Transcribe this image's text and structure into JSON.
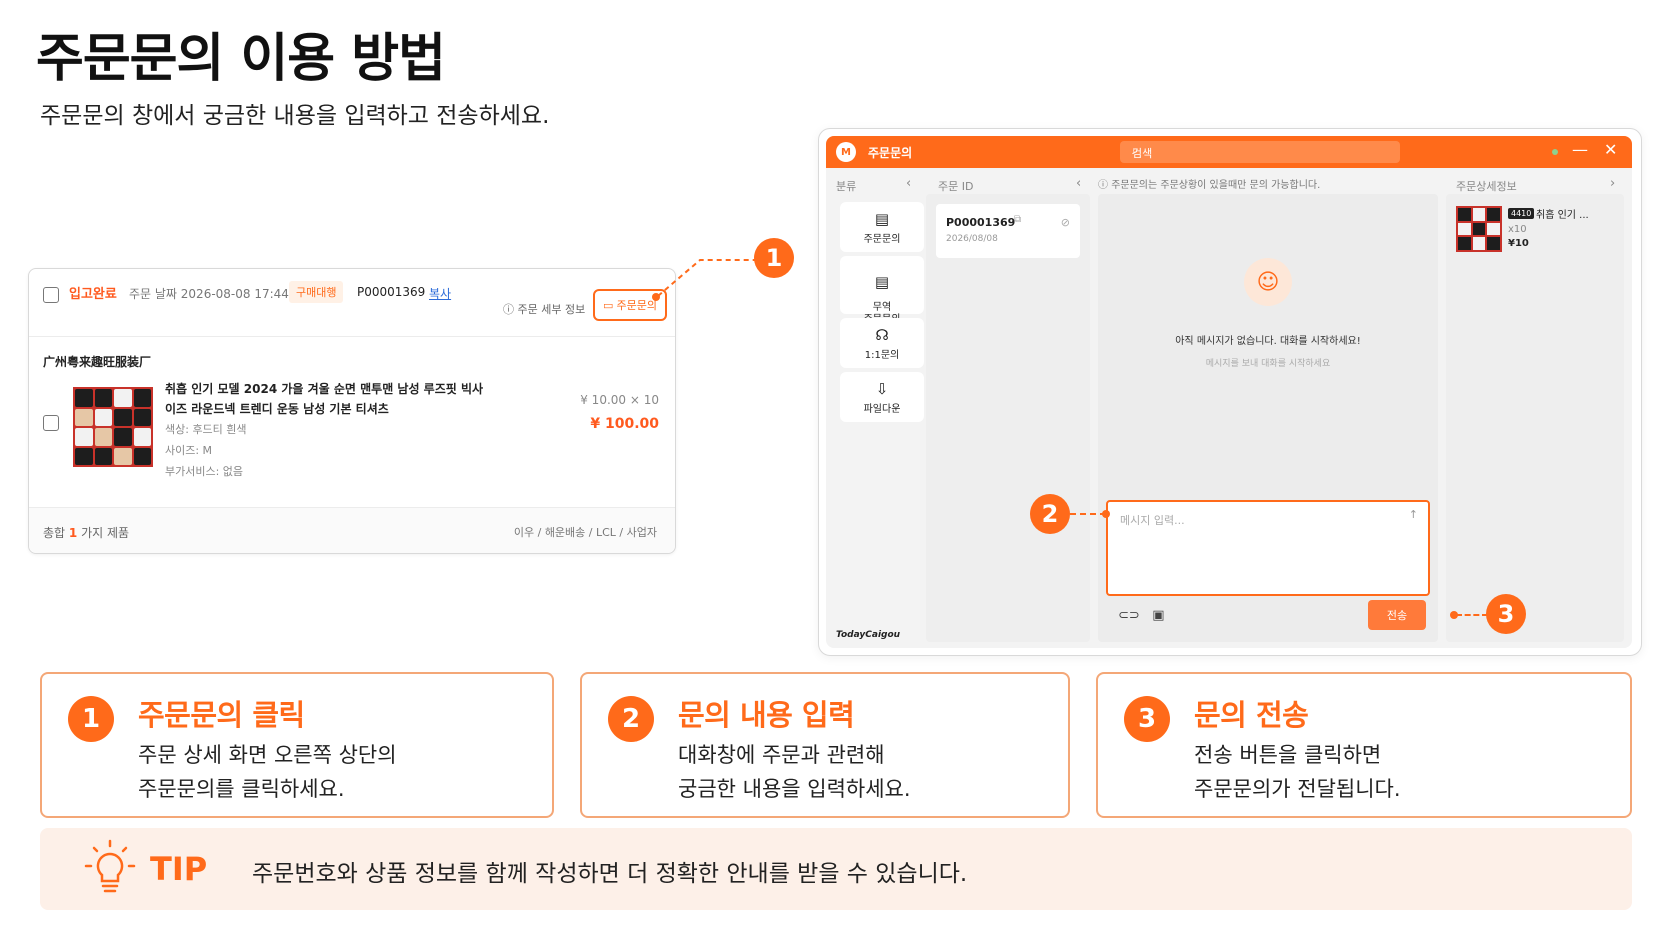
{
  "page": {
    "title": "주문문의 이용 방법",
    "subtitle": "주문문의 창에서 궁금한 내용을 입력하고 전송하세요."
  },
  "order_card": {
    "status": "입고완료",
    "date_label": "주문 날짜 2026-08-08 17:44",
    "badge": "구매대행",
    "order_id": "P00001369",
    "copy_label": "복사",
    "detail_label": "주문 세부 정보",
    "inquiry_label": "주문문의",
    "seller": "广州粤来趣旺服装厂",
    "product_name": "취흡 인기 모델 2024 가을 겨울 순면 맨투맨 남성 루즈핏 빅사이즈 라운드넥 트렌디 운동 남성 기본 티셔츠",
    "option_color": "색상: 후드티 흰색",
    "option_size": "사이즈: M",
    "option_extra": "부가서비스: 없음",
    "unit_price": "¥ 10.00 × 10",
    "total_price": "¥ 100.00",
    "footer_total_prefix": "총합",
    "footer_total_count": "1",
    "footer_total_suffix": "가지 제품",
    "footer_shipping": "이우 / 해운배송 / LCL / 사업자"
  },
  "markers": {
    "one": "1",
    "two": "2",
    "three": "3"
  },
  "window": {
    "logo": "M",
    "title": "주문문의",
    "search_placeholder": "검색",
    "col_category": "분류",
    "col_order_id": "주문 ID",
    "col_detail": "주문상세정보",
    "notice": "주문문의는 주문상황이 있을때만 문의 가능합니다.",
    "side_items": [
      {
        "label": "주문문의"
      },
      {
        "label": "무역\n주문문의"
      },
      {
        "label": "1:1문의"
      },
      {
        "label": "파일다운"
      }
    ],
    "brand": "TodayCaigou",
    "order_item": {
      "id": "P00001369",
      "date": "2026/08/08"
    },
    "empty_title": "아직 메시지가 없습니다. 대화를 시작하세요!",
    "empty_sub": "메시지를 보내 대화를 시작하세요",
    "input_placeholder": "메시지 입력...",
    "send_label": "전송",
    "detail_tag": "4410",
    "detail_name": "취흡 인기 ...",
    "detail_qty": "x10",
    "detail_price": "¥10"
  },
  "steps": [
    {
      "num": "1",
      "title": "주문문의 클릭",
      "line1": "주문 상세 화면 오른쪽 상단의",
      "line2": "주문문의를 클릭하세요."
    },
    {
      "num": "2",
      "title": "문의 내용 입력",
      "line1": "대화창에 주문과 관련해",
      "line2": "궁금한 내용을 입력하세요."
    },
    {
      "num": "3",
      "title": "문의 전송",
      "line1": "전송 버튼을 클릭하면",
      "line2": "주문문의가 전달됩니다."
    }
  ],
  "tip": {
    "label": "TIP",
    "text": "주문번호와 상품 정보를 함께 작성하면 더 정확한 안내를 받을 수 있습니다."
  },
  "colors": {
    "accent": "#ff6a1a",
    "tip_bg": "#fdf0e8",
    "step_border": "#f4a777"
  }
}
